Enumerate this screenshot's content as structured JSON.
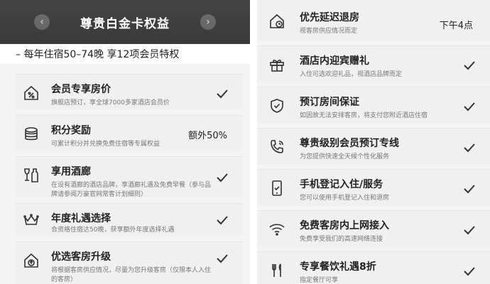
{
  "left": {
    "header_title": "尊贵白金卡权益",
    "nav_prev": "‹",
    "nav_next": "›",
    "subtitle": "– 每年住宿50–74晚 享12项会员特权",
    "items": [
      {
        "name": "会员专享房价",
        "desc": "旗舰店预订，享全球7000多家酒店会员价",
        "icon": "percent-house-icon",
        "status": "check"
      },
      {
        "name": "积分奖励",
        "desc": "可累计积分并兑换免费住宿等专属权益",
        "icon": "coins-icon",
        "value": "额外50%"
      },
      {
        "name": "享用酒廊",
        "desc": "在设有酒廊的酒店品牌，享酒廊礼遇及免费早餐（参与品牌请参阅万豪官网常客计划细则）",
        "icon": "wine-icon",
        "status": "check"
      },
      {
        "name": "年度礼遇选择",
        "desc": "合资格住宿达50晚，获享额外年度选择礼遇",
        "icon": "crown-icon",
        "status": "check"
      },
      {
        "name": "优选客房升级",
        "desc": "将根据客房供应情况，尽量为您升级客房（仅限本人入住的客房）",
        "icon": "upgrade-house-icon",
        "status": "check"
      }
    ]
  },
  "right": {
    "items": [
      {
        "name": "优先延迟退房",
        "desc": "视客房供应情况而定",
        "icon": "clock-house-icon",
        "value": "下午4点"
      },
      {
        "name": "酒店内迎宾赠礼",
        "desc": "入住可选欢迎礼品，视酒店品牌而定",
        "icon": "gift-icon",
        "status": "check"
      },
      {
        "name": "预订房间保证",
        "desc": "如因故无法安排客房，将支付您附近酒店住宿",
        "icon": "shield-check-icon",
        "status": "check"
      },
      {
        "name": "尊贵级别会员预订专线",
        "desc": "为您提供快速全天候个性化服务",
        "icon": "phone-icon",
        "status": "check"
      },
      {
        "name": "手机登记入住/服务",
        "desc": "您可以使用手机登记入住和退房",
        "icon": "mobile-check-icon",
        "status": "check"
      },
      {
        "name": "免费客房内上网接入",
        "desc": "免费享受我们的高速网络连接",
        "icon": "wifi-icon",
        "status": "check"
      },
      {
        "name": "专享餐饮礼遇8折",
        "desc": "指定餐厅可享",
        "icon": "dining-icon",
        "status": "check"
      }
    ]
  }
}
